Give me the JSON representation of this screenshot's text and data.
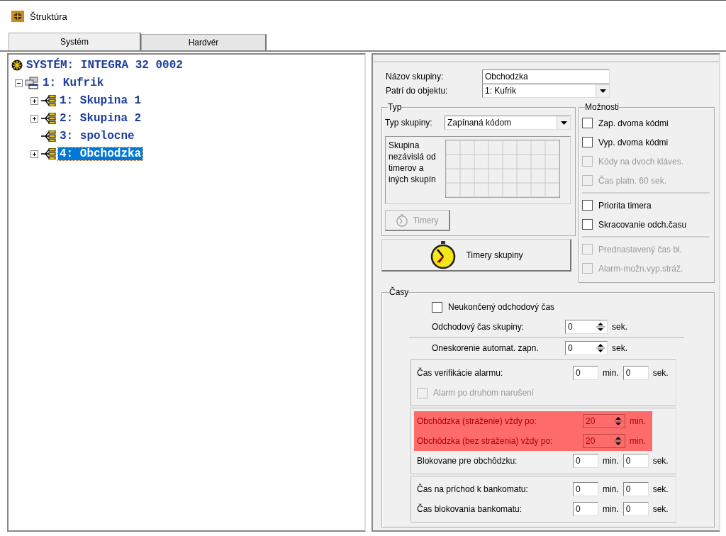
{
  "window": {
    "title": "Štruktúra"
  },
  "tabs": [
    {
      "label": "Systém",
      "selected": true
    },
    {
      "label": "Hardvér",
      "selected": false
    }
  ],
  "tree": {
    "label": "SYSTÉM: INTEGRA 32 0002",
    "children": [
      {
        "label": "1: Kufrik",
        "expanded": true,
        "children": [
          {
            "label": "1: Skupina 1",
            "expandable": true,
            "selected": false
          },
          {
            "label": "2: Skupina 2",
            "expandable": true,
            "selected": false
          },
          {
            "label": "3: spolocne",
            "expandable": false,
            "selected": false
          },
          {
            "label": "4: Obchodzka",
            "expandable": true,
            "selected": true
          }
        ]
      }
    ]
  },
  "group_form": {
    "name_label": "Názov skupiny:",
    "name_value": "Obchodzka",
    "object_label": "Patrí do objektu:",
    "object_value": "1: Kufrik"
  },
  "type_group": {
    "title": "Typ",
    "type_label": "Typ skupiny:",
    "type_value": "Zapínaná kódom",
    "description": "Skupina nezávislá od timerov a iných skupín",
    "timers_button": {
      "label": "Timery",
      "disabled": true
    }
  },
  "group_timers_button": {
    "label": "Timery skupiny"
  },
  "options": {
    "title": "Možnosti",
    "sections": [
      {
        "items": [
          {
            "label": "Zap. dvoma kódmi",
            "checked": false,
            "disabled": false
          },
          {
            "label": "Vyp. dvoma kódmi",
            "checked": false,
            "disabled": false
          },
          {
            "label": "Kódy na dvoch kláves.",
            "checked": false,
            "disabled": true
          },
          {
            "label": "Čas platn. 60 sek.",
            "checked": false,
            "disabled": true
          }
        ]
      },
      {
        "items": [
          {
            "label": "Priorita timera",
            "checked": false,
            "disabled": false
          },
          {
            "label": "Skracovanie odch.času",
            "checked": false,
            "disabled": false
          }
        ]
      },
      {
        "items": [
          {
            "label": "Prednastavený čas bl.",
            "checked": false,
            "disabled": true
          },
          {
            "label": "Alarm-možn.vyp.stráž.",
            "checked": false,
            "disabled": true
          }
        ]
      }
    ]
  },
  "times": {
    "title": "Časy",
    "sections": [
      {
        "kind": "plain",
        "rows": [
          {
            "kind": "checkbox",
            "label": "Neukončený odchodový čas",
            "checked": false,
            "disabled": false
          },
          {
            "kind": "spin",
            "label": "Odchodový čas skupiny:",
            "value": "0",
            "unit": "sek."
          }
        ]
      },
      {
        "kind": "plain",
        "rows": [
          {
            "kind": "spin",
            "label": "Oneskorenie automat. zapn.",
            "value": "0",
            "unit": "sek."
          }
        ]
      },
      {
        "kind": "box",
        "rows": [
          {
            "kind": "minsec",
            "label": "Čas verifikácie alarmu:",
            "min": "0",
            "min_unit": "min.",
            "sec": "0",
            "sec_unit": "sek."
          },
          {
            "kind": "checkbox",
            "label": "Alarm po druhom narušení",
            "checked": false,
            "disabled": true
          }
        ]
      },
      {
        "kind": "box",
        "rows": [
          {
            "kind": "spin",
            "label": "Obchôdzka (stráženie) vždy po:",
            "value": "20",
            "unit": "min.",
            "highlighted": true
          },
          {
            "kind": "spin",
            "label": "Obchôdzka (bez stráženia) vždy po:",
            "value": "20",
            "unit": "min.",
            "highlighted": true
          },
          {
            "kind": "minsec",
            "label": "Blokovane pre obchôdzku:",
            "min": "0",
            "min_unit": "min.",
            "sec": "0",
            "sec_unit": "sek.",
            "highlighted": false
          }
        ]
      },
      {
        "kind": "box",
        "rows": [
          {
            "kind": "minsec",
            "label": "Čas na príchod k bankomatu:",
            "min": "0",
            "min_unit": "min.",
            "sec": "0",
            "sec_unit": "sek."
          },
          {
            "kind": "minsec",
            "label": "Čas blokovania bankomatu:",
            "min": "0",
            "min_unit": "min.",
            "sec": "0",
            "sec_unit": "sek."
          }
        ]
      }
    ]
  }
}
